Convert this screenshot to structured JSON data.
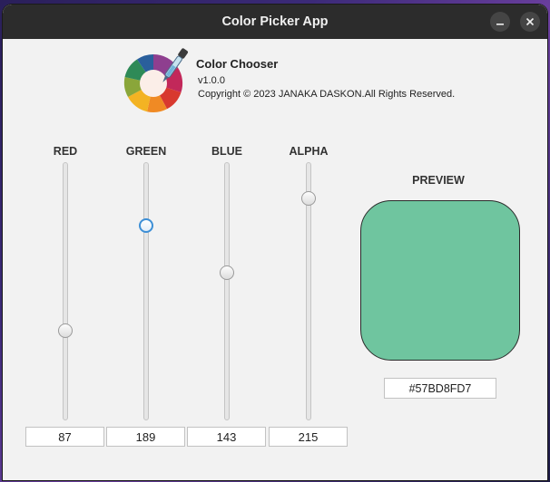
{
  "window": {
    "title": "Color Picker App",
    "buttons": [
      "minimize-icon",
      "close-icon"
    ]
  },
  "about": {
    "name": "Color Chooser",
    "version": "v1.0.0",
    "copyright": "Copyright © 2023 JANAKA DASKON.All Rights Reserved."
  },
  "sliders": [
    {
      "label": "RED",
      "value": "87",
      "max": 255
    },
    {
      "label": "GREEN",
      "value": "189",
      "max": 255
    },
    {
      "label": "BLUE",
      "value": "143",
      "max": 255
    },
    {
      "label": "ALPHA",
      "value": "215",
      "max": 255
    }
  ],
  "preview": {
    "label": "PREVIEW",
    "hex": "#57BD8FD7",
    "color": "#57BD8F",
    "alpha": 0.843
  }
}
